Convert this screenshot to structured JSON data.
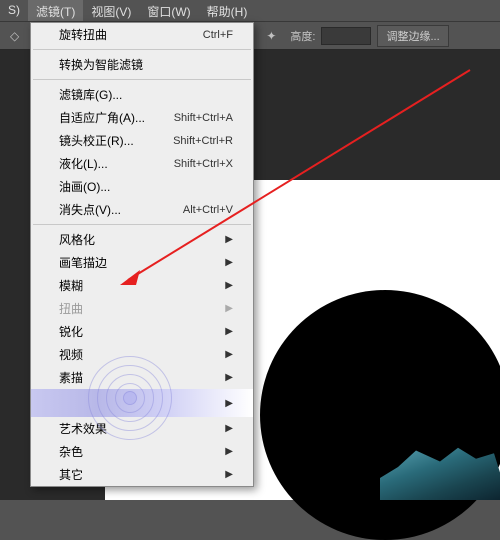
{
  "menubar": {
    "items": [
      {
        "label": "S)"
      },
      {
        "label": "滤镜(T)"
      },
      {
        "label": "视图(V)"
      },
      {
        "label": "窗口(W)"
      },
      {
        "label": "帮助(H)"
      }
    ],
    "active_index": 1
  },
  "toolbar": {
    "height_label": "高度:",
    "height_value": "",
    "edge_button": "调整边缘..."
  },
  "dropdown": {
    "sections": [
      [
        {
          "label": "旋转扭曲",
          "shortcut": "Ctrl+F",
          "submenu": false,
          "disabled": false
        }
      ],
      [
        {
          "label": "转换为智能滤镜",
          "shortcut": "",
          "submenu": false,
          "disabled": false
        }
      ],
      [
        {
          "label": "滤镜库(G)...",
          "shortcut": "",
          "submenu": false,
          "disabled": false
        },
        {
          "label": "自适应广角(A)...",
          "shortcut": "Shift+Ctrl+A",
          "submenu": false,
          "disabled": false
        },
        {
          "label": "镜头校正(R)...",
          "shortcut": "Shift+Ctrl+R",
          "submenu": false,
          "disabled": false
        },
        {
          "label": "液化(L)...",
          "shortcut": "Shift+Ctrl+X",
          "submenu": false,
          "disabled": false
        },
        {
          "label": "油画(O)...",
          "shortcut": "",
          "submenu": false,
          "disabled": false
        },
        {
          "label": "消失点(V)...",
          "shortcut": "Alt+Ctrl+V",
          "submenu": false,
          "disabled": false
        }
      ],
      [
        {
          "label": "风格化",
          "shortcut": "",
          "submenu": true,
          "disabled": false
        },
        {
          "label": "画笔描边",
          "shortcut": "",
          "submenu": true,
          "disabled": false
        },
        {
          "label": "模糊",
          "shortcut": "",
          "submenu": true,
          "disabled": false
        },
        {
          "label": "扭曲",
          "shortcut": "",
          "submenu": true,
          "disabled": true
        },
        {
          "label": "锐化",
          "shortcut": "",
          "submenu": true,
          "disabled": false
        },
        {
          "label": "视频",
          "shortcut": "",
          "submenu": true,
          "disabled": false
        },
        {
          "label": "素描",
          "shortcut": "",
          "submenu": true,
          "disabled": false
        },
        {
          "label": "",
          "shortcut": "",
          "submenu": true,
          "disabled": false,
          "highlighted": true
        },
        {
          "label": "艺术效果",
          "shortcut": "",
          "submenu": true,
          "disabled": false
        },
        {
          "label": "杂色",
          "shortcut": "",
          "submenu": true,
          "disabled": false
        },
        {
          "label": "其它",
          "shortcut": "",
          "submenu": true,
          "disabled": false
        }
      ]
    ]
  }
}
